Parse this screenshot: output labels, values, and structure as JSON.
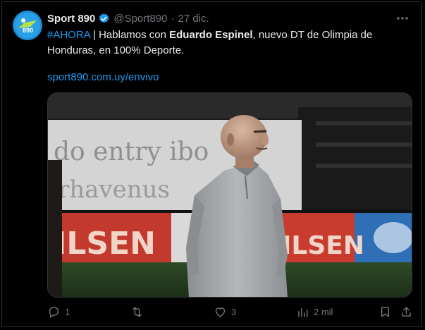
{
  "tweet": {
    "author_name": "Sport 890",
    "handle": "@Sport890",
    "separator": "·",
    "date": "27 dic.",
    "text": {
      "hashtag": "#AHORA",
      "part1": " | Hablamos con ",
      "bold_name": "Eduardo Espinel",
      "part2": ", nuevo DT de Olimpia de Honduras, en 100% Deporte."
    },
    "link": "sport890.com.uy/envivo",
    "image": {
      "board_top_text": "do entry ibo",
      "board_bottom_text": "rhavenus",
      "ad_text_left": "ILSEN",
      "ad_text_right": "ILSEN",
      "avatar_text": "890"
    }
  },
  "actions": {
    "replies": "1",
    "reposts": "",
    "likes": "3",
    "views": "2 mil"
  },
  "colors": {
    "background": "#000000",
    "text": "#e7e9ea",
    "muted": "#71767b",
    "accent": "#1d9bf0"
  }
}
